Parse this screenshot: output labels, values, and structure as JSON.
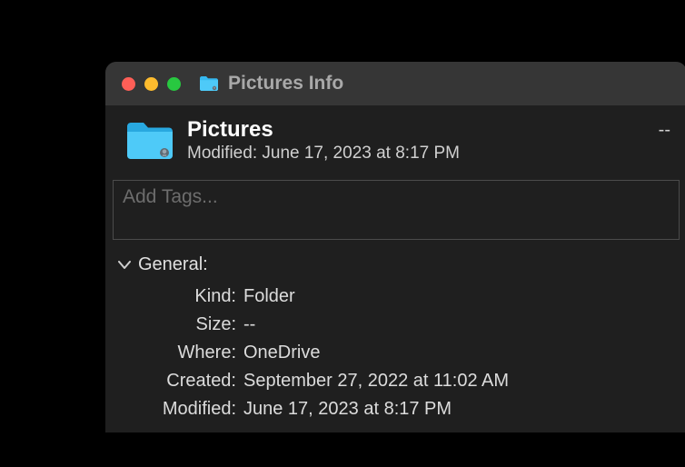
{
  "window": {
    "title": "Pictures Info"
  },
  "header": {
    "name": "Pictures",
    "modified_label": "Modified:",
    "modified_value": "June 17, 2023 at 8:17 PM",
    "size_display": "--"
  },
  "tags": {
    "placeholder": "Add Tags..."
  },
  "general": {
    "title": "General:",
    "rows": {
      "kind_label": "Kind:",
      "kind_value": "Folder",
      "size_label": "Size:",
      "size_value": "--",
      "where_label": "Where:",
      "where_value": "OneDrive",
      "created_label": "Created:",
      "created_value": "September 27, 2022 at 11:02 AM",
      "modified_label": "Modified:",
      "modified_value": "June 17, 2023 at 8:17 PM"
    }
  }
}
